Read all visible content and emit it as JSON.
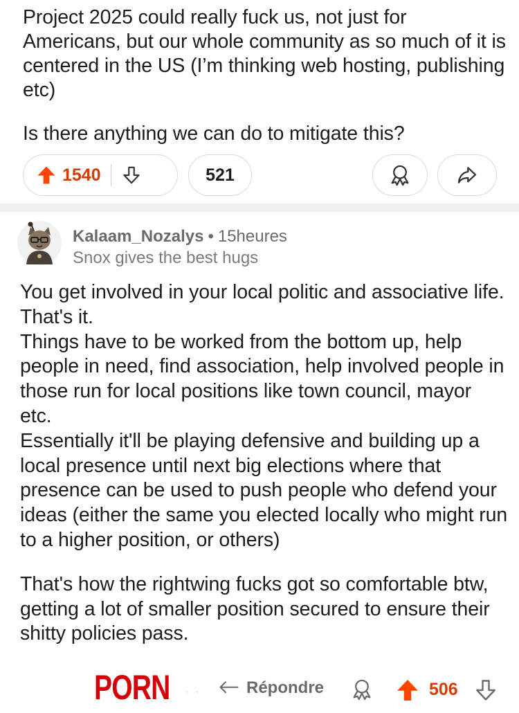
{
  "post": {
    "paragraph1": "Project 2025 could really fuck us, not just for Americans, but our whole community as so much of it is centered in the US (I’m thinking web hosting, publishing etc)",
    "paragraph2": "Is there anything we can do to mitigate this?",
    "upvotes": "1540",
    "comments": "521"
  },
  "comment": {
    "author": "Kalaam_Nozalys",
    "separator": "•",
    "time": "15heures",
    "flair": "Snox gives the best hugs",
    "paragraph1": "You get involved in your local politic and associative life. That's it.\nThings have to be worked from the bottom up, help people in need, find  association, help involved people in those run for local positions like town council, mayor etc.\nEssentially it'll be playing defensive and building up a local presence until next big elections where that presence can be used to push people who defend your ideas (either the same you elected locally who might run to a higher position, or others)",
    "paragraph2": "That's how the rightwing fucks got so comfortable btw, getting a lot of smaller position secured to ensure their shitty policies pass.",
    "reply_label": "Répondre",
    "upvotes": "506"
  },
  "watermark": {
    "text": "PORN",
    "dots": "· ·"
  },
  "colors": {
    "upvote": "#ff4500",
    "vote_count": "#d93a00",
    "watermark": "#d5000a",
    "divider": "#eeeff1"
  },
  "icons": {
    "upvote": "arrow-up-filled-icon",
    "downvote": "arrow-down-outline-icon",
    "award": "award-icon",
    "share": "share-icon",
    "reply": "reply-icon"
  }
}
